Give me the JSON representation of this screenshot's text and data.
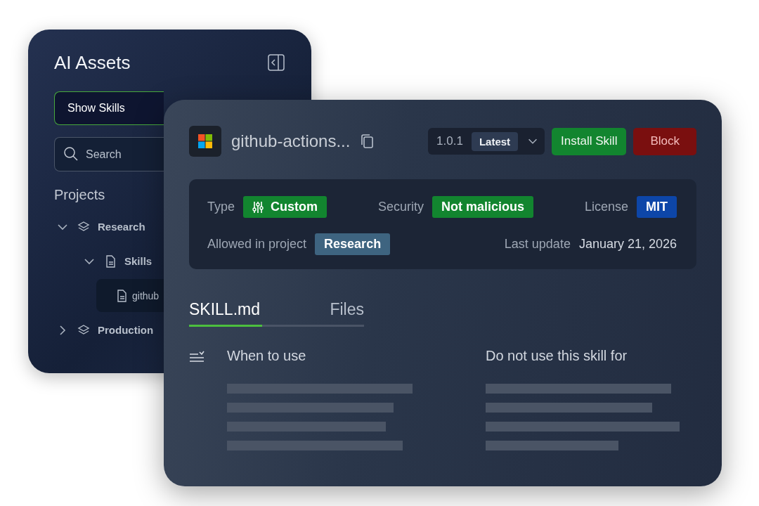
{
  "sidebar": {
    "title": "AI Assets",
    "filter": {
      "value": "Show Skills"
    },
    "search": {
      "placeholder": "Search"
    },
    "section": "Projects",
    "tree": [
      {
        "label": "Research",
        "kind": "project",
        "expanded": true,
        "selected": false,
        "children": [
          {
            "label": "Skills",
            "kind": "folder",
            "expanded": true,
            "selected": false,
            "children": [
              {
                "label": "github",
                "kind": "file",
                "selected": true
              }
            ]
          }
        ]
      },
      {
        "label": "Production",
        "kind": "project",
        "expanded": false,
        "selected": false
      }
    ]
  },
  "skill": {
    "name": "github-actions...",
    "version": "1.0.1",
    "version_tag": "Latest",
    "actions": [
      {
        "label": "Install Skill",
        "kind": "primary"
      },
      {
        "label": "Block",
        "kind": "danger"
      }
    ],
    "detail_rows": [
      {
        "items": [
          {
            "label": "Type",
            "value": "Custom",
            "kind": "badge",
            "color": "#12852f",
            "icon": true
          },
          {
            "label": "Security",
            "value": "Not malicious",
            "kind": "badge",
            "color": "#12852f"
          },
          {
            "label": "License",
            "value": "MIT",
            "kind": "badge",
            "color": "#0d46a8"
          }
        ]
      },
      {
        "items": [
          {
            "label": "Allowed in project",
            "value": "Research",
            "kind": "badge",
            "color": "#3e6480"
          },
          {
            "label": "Last update",
            "value": "January 21, 2026",
            "kind": "text"
          }
        ]
      }
    ],
    "tabs": [
      {
        "label": "SKILL.md",
        "selected": true
      },
      {
        "label": "Files",
        "selected": false
      }
    ],
    "sections": [
      {
        "title": "When to use",
        "kind": "checklist"
      },
      {
        "title": "Do not use this skill for",
        "kind": "plain"
      }
    ]
  }
}
